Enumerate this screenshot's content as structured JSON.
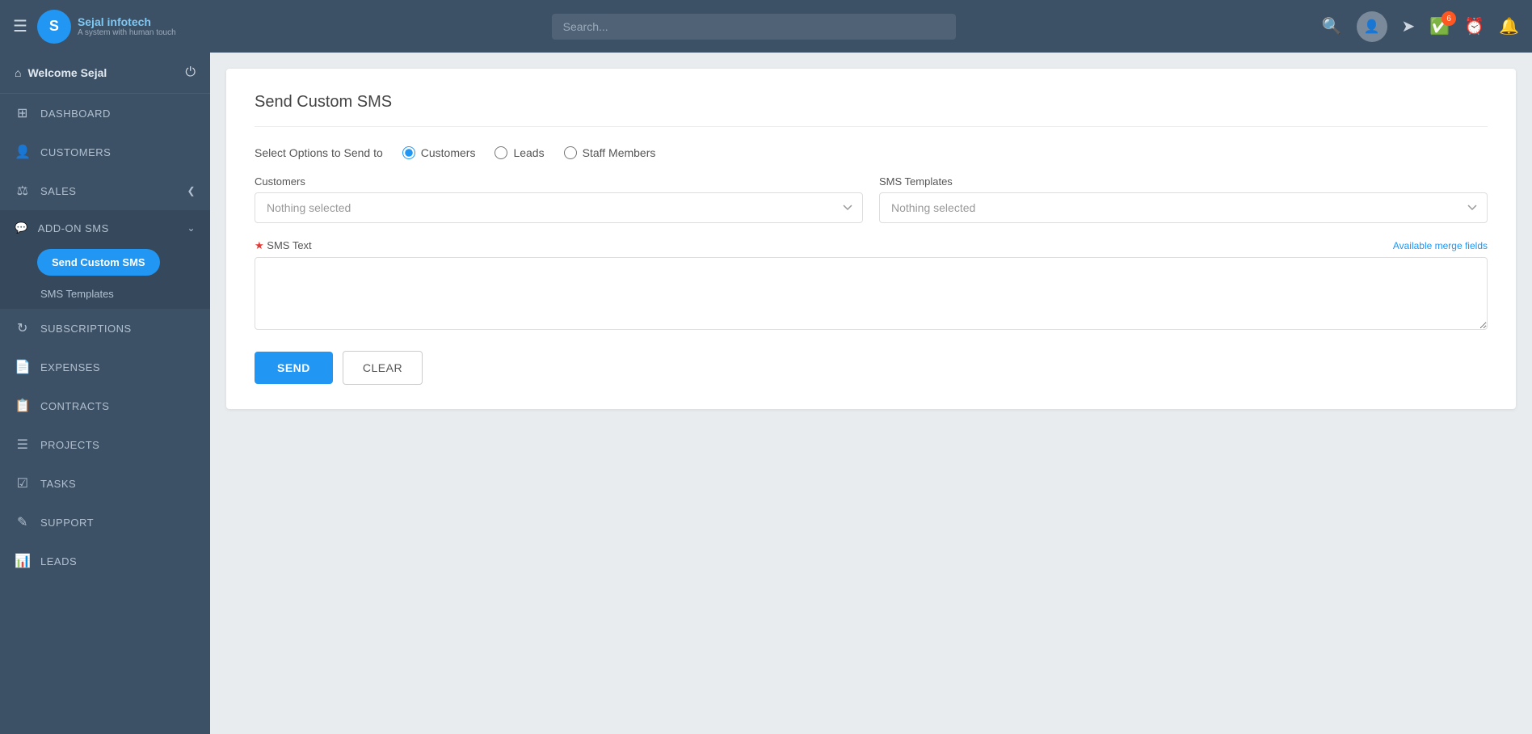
{
  "app": {
    "title": "Sejal infotech",
    "subtitle": "A system with human touch"
  },
  "topbar": {
    "search_placeholder": "Search...",
    "badge_count": "6",
    "welcome_label": "Welcome Sejal"
  },
  "sidebar": {
    "welcome": "Welcome Sejal",
    "items": [
      {
        "id": "dashboard",
        "label": "DASHBOARD",
        "icon": "⊞"
      },
      {
        "id": "customers",
        "label": "CUSTOMERS",
        "icon": "👤"
      },
      {
        "id": "sales",
        "label": "SALES",
        "icon": "⚖",
        "has_sub": true
      },
      {
        "id": "addon-sms",
        "label": "ADD-ON SMS",
        "icon": "💬",
        "has_sub": true
      },
      {
        "id": "subscriptions",
        "label": "SUBSCRIPTIONS",
        "icon": "↺"
      },
      {
        "id": "expenses",
        "label": "EXPENSES",
        "icon": "📄"
      },
      {
        "id": "contracts",
        "label": "CONTRACTS",
        "icon": "📋"
      },
      {
        "id": "projects",
        "label": "PROJECTS",
        "icon": "☰"
      },
      {
        "id": "tasks",
        "label": "TASKS",
        "icon": "☑"
      },
      {
        "id": "support",
        "label": "SUPPORT",
        "icon": "✏"
      },
      {
        "id": "leads",
        "label": "LEADS",
        "icon": "📊"
      }
    ],
    "addon_sub_items": [
      {
        "id": "send-custom-sms",
        "label": "Send Custom SMS",
        "active": true
      },
      {
        "id": "sms-templates",
        "label": "SMS Templates"
      }
    ]
  },
  "page": {
    "title": "Send Custom SMS",
    "select_options_label": "Select Options to Send to",
    "radio_options": [
      {
        "id": "customers",
        "label": "Customers",
        "checked": true
      },
      {
        "id": "leads",
        "label": "Leads",
        "checked": false
      },
      {
        "id": "staff-members",
        "label": "Staff Members",
        "checked": false
      }
    ],
    "customers_dropdown": {
      "label": "Customers",
      "placeholder": "Nothing selected"
    },
    "sms_templates_dropdown": {
      "label": "SMS Templates",
      "placeholder": "Nothing selected"
    },
    "sms_text": {
      "label": "SMS Text",
      "required": true,
      "merge_fields_link": "Available merge fields"
    },
    "buttons": {
      "send": "SEND",
      "clear": "CLEAR"
    }
  }
}
